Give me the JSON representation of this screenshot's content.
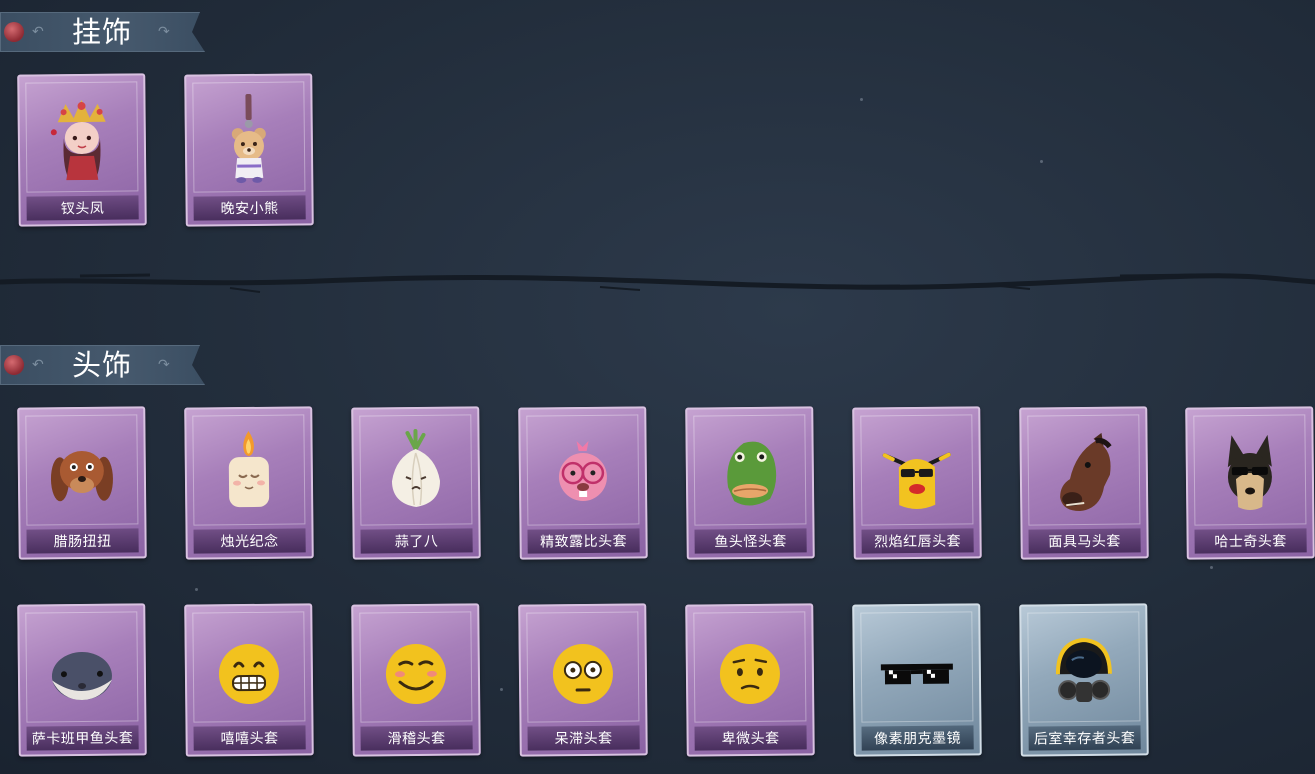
{
  "sections": [
    {
      "title": "挂饰",
      "items": [
        {
          "label": "钗头凤",
          "rarity": "purple",
          "icon": "phoenix-crown-doll-icon"
        },
        {
          "label": "晚安小熊",
          "rarity": "purple",
          "icon": "teddy-bear-charm-icon"
        }
      ]
    },
    {
      "title": "头饰",
      "items": [
        {
          "label": "腊肠扭扭",
          "rarity": "purple",
          "icon": "dachshund-dog-head-icon"
        },
        {
          "label": "烛光纪念",
          "rarity": "purple",
          "icon": "candle-head-icon"
        },
        {
          "label": "蒜了八",
          "rarity": "purple",
          "icon": "garlic-head-icon"
        },
        {
          "label": "精致露比头套",
          "rarity": "purple",
          "icon": "pink-beaver-glasses-head-icon"
        },
        {
          "label": "鱼头怪头套",
          "rarity": "purple",
          "icon": "fish-head-mask-icon"
        },
        {
          "label": "烈焰红唇头套",
          "rarity": "purple",
          "icon": "yellow-red-lips-sunglasses-head-icon"
        },
        {
          "label": "面具马头套",
          "rarity": "purple",
          "icon": "horse-head-mask-icon"
        },
        {
          "label": "哈士奇头套",
          "rarity": "purple",
          "icon": "husky-sunglasses-head-icon"
        },
        {
          "label": "萨卡班甲鱼头套",
          "rarity": "purple",
          "icon": "sacabambaspis-fish-head-icon"
        },
        {
          "label": "嘻嘻头套",
          "rarity": "purple",
          "icon": "grinning-emoji-head-icon"
        },
        {
          "label": "滑稽头套",
          "rarity": "purple",
          "icon": "smirk-emoji-head-icon"
        },
        {
          "label": "呆滞头套",
          "rarity": "purple",
          "icon": "dazed-emoji-head-icon"
        },
        {
          "label": "卑微头套",
          "rarity": "purple",
          "icon": "pleading-emoji-head-icon"
        },
        {
          "label": "像素朋克墨镜",
          "rarity": "blue",
          "icon": "pixel-sunglasses-icon"
        },
        {
          "label": "后室幸存者头套",
          "rarity": "blue",
          "icon": "gas-mask-helmet-icon"
        }
      ]
    }
  ],
  "colors": {
    "background": "#222d3b",
    "purple_card": "#a77fba",
    "blue_card": "#93a9bb",
    "label_text": "#ffffff"
  }
}
